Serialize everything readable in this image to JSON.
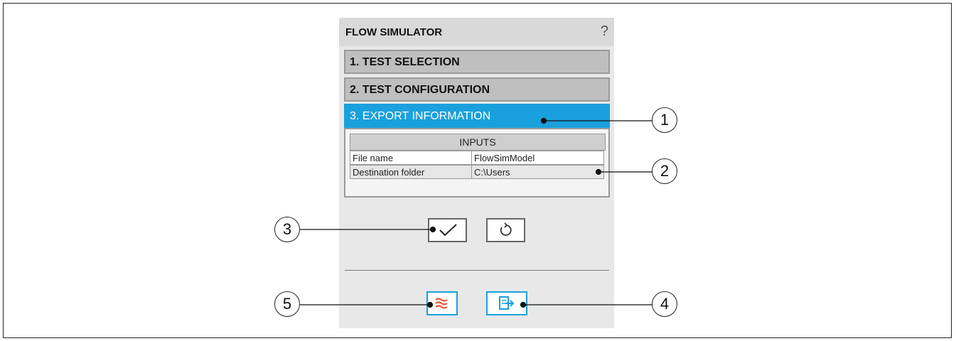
{
  "window": {
    "title": "FLOW SIMULATOR",
    "help": "?"
  },
  "steps": [
    {
      "label": "1. TEST SELECTION",
      "active": false
    },
    {
      "label": "2. TEST CONFIGURATION",
      "active": false
    },
    {
      "label": "3. EXPORT INFORMATION",
      "active": true
    }
  ],
  "inputs": {
    "header": "INPUTS",
    "rows": [
      {
        "key": "File name",
        "value": "FlowSimModel"
      },
      {
        "key": "Destination folder",
        "value": "C:\\Users"
      }
    ]
  },
  "actions": {
    "confirm_icon": "check-icon",
    "reset_icon": "rotate-icon"
  },
  "footer": {
    "left_icon": "flow-waves-icon",
    "right_icon": "export-icon"
  },
  "callouts": [
    "1",
    "2",
    "3",
    "4",
    "5"
  ],
  "colors": {
    "accent": "#1aa0dc",
    "flow_icon": "#e8553c"
  }
}
